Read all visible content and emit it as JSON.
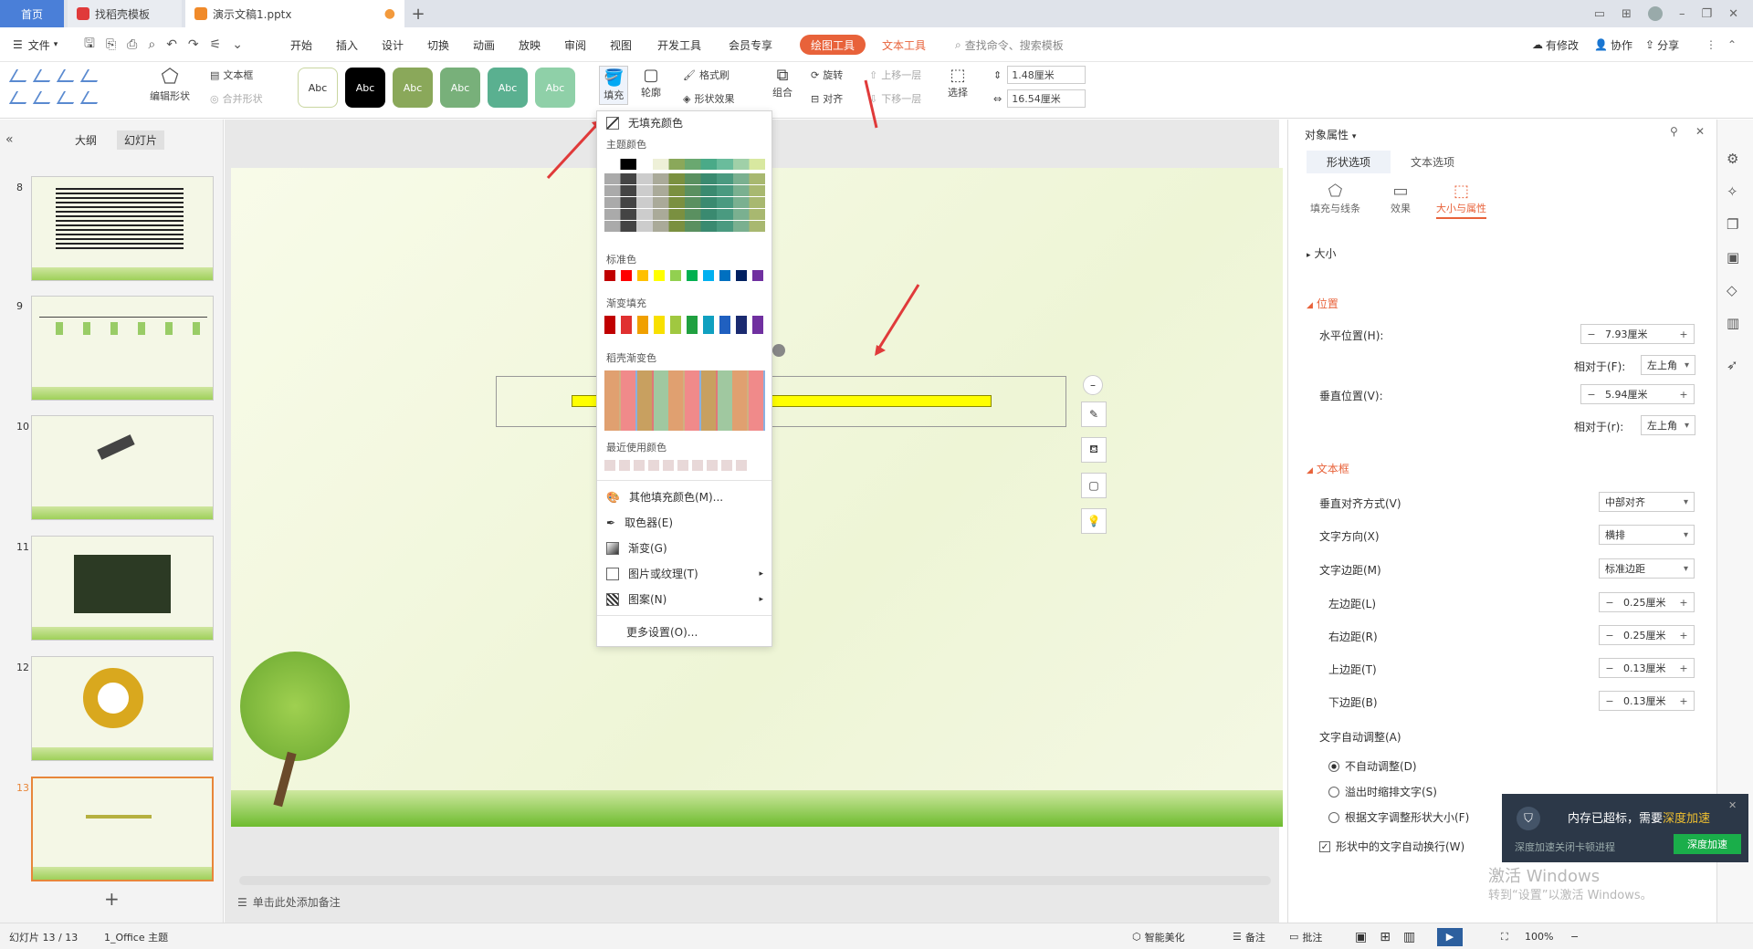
{
  "tabs": [
    {
      "label": "首页"
    },
    {
      "label": "找稻壳模板"
    },
    {
      "label": "演示文稿1.pptx"
    }
  ],
  "menu": {
    "file": "文件",
    "items": [
      "开始",
      "插入",
      "设计",
      "切换",
      "动画",
      "放映",
      "审阅",
      "视图",
      "开发工具",
      "会员专享"
    ],
    "active": "绘图工具",
    "text_tool": "文本工具",
    "search": "查找命令、搜索模板",
    "right": [
      "有修改",
      "协作",
      "分享"
    ]
  },
  "toolbar": {
    "edit_shape": "编辑形状",
    "textbox": "文本框",
    "merge_shape": "合并形状",
    "abc": "Abc",
    "fill": "填充",
    "outline": "轮廓",
    "format_brush": "格式刷",
    "shape_effect": "形状效果",
    "group": "组合",
    "rotate": "旋转",
    "align": "对齐",
    "bring_forward": "上移一层",
    "send_backward": "下移一层",
    "select": "选择",
    "height": "1.48厘米",
    "width": "16.54厘米"
  },
  "left_panel": {
    "tab_outline": "大纲",
    "tab_slides": "幻灯片",
    "slide_numbers": [
      "8",
      "9",
      "10",
      "11",
      "12",
      "13"
    ]
  },
  "fill_dropdown": {
    "no_fill": "无填充颜色",
    "theme_colors": "主题颜色",
    "standard_colors": "标准色",
    "gradient_fill": "渐变填充",
    "docer_gradient": "稻壳渐变色",
    "recent_colors": "最近使用颜色",
    "more_fill": "其他填充颜色(M)...",
    "eyedropper": "取色器(E)",
    "gradient": "渐变(G)",
    "picture_texture": "图片或纹理(T)",
    "pattern": "图案(N)",
    "more_settings": "更多设置(O)...",
    "standard_swatches": [
      "#c00000",
      "#ff0000",
      "#ffc000",
      "#ffff00",
      "#92d050",
      "#00b050",
      "#00b0f0",
      "#0070c0",
      "#002060",
      "#7030a0"
    ],
    "gradient_swatches": [
      "#c00000",
      "#e03030",
      "#f0a000",
      "#f8e000",
      "#a0c840",
      "#20a040",
      "#10a0c0",
      "#2060c0",
      "#1a2a70",
      "#7030a0"
    ]
  },
  "right_panel": {
    "title": "对象属性",
    "tab_shape": "形状选项",
    "tab_text": "文本选项",
    "sub_fill": "填充与线条",
    "sub_effect": "效果",
    "sub_size": "大小与属性",
    "size": "大小",
    "position": "位置",
    "h_pos": "水平位置(H):",
    "h_pos_val": "7.93厘米",
    "rel_f": "相对于(F):",
    "rel_f_val": "左上角",
    "v_pos": "垂直位置(V):",
    "v_pos_val": "5.94厘米",
    "rel_r": "相对于(r):",
    "rel_r_val": "左上角",
    "textbox": "文本框",
    "v_align": "垂直对齐方式(V)",
    "v_align_val": "中部对齐",
    "text_dir": "文字方向(X)",
    "text_dir_val": "横排",
    "margin": "文字边距(M)",
    "margin_val": "标准边距",
    "left_m": "左边距(L)",
    "left_m_val": "0.25厘米",
    "right_m": "右边距(R)",
    "right_m_val": "0.25厘米",
    "top_m": "上边距(T)",
    "top_m_val": "0.13厘米",
    "bottom_m": "下边距(B)",
    "bottom_m_val": "0.13厘米",
    "autofit": "文字自动调整(A)",
    "opt1": "不自动调整(D)",
    "opt2": "溢出时缩排文字(S)",
    "opt3": "根据文字调整形状大小(F)",
    "wrap": "形状中的文字自动换行(W)"
  },
  "popup": {
    "text": "内存已超标，需要",
    "link": "深度加速",
    "sub": "深度加速关闭卡顿进程",
    "button": "深度加速"
  },
  "watermark": {
    "line1": "激活 Windows",
    "line2": "转到“设置”以激活 Windows。"
  },
  "status": {
    "slide": "幻灯片 13 / 13",
    "theme": "1_Office 主题",
    "notes_placeholder": "单击此处添加备注",
    "beautify": "智能美化",
    "notes": "备注",
    "comments": "批注",
    "zoom": "100%"
  },
  "colors": {
    "accent": "#e8623a",
    "yellow_bar": "#ffff00",
    "selected_thumb": "#e8863a"
  }
}
